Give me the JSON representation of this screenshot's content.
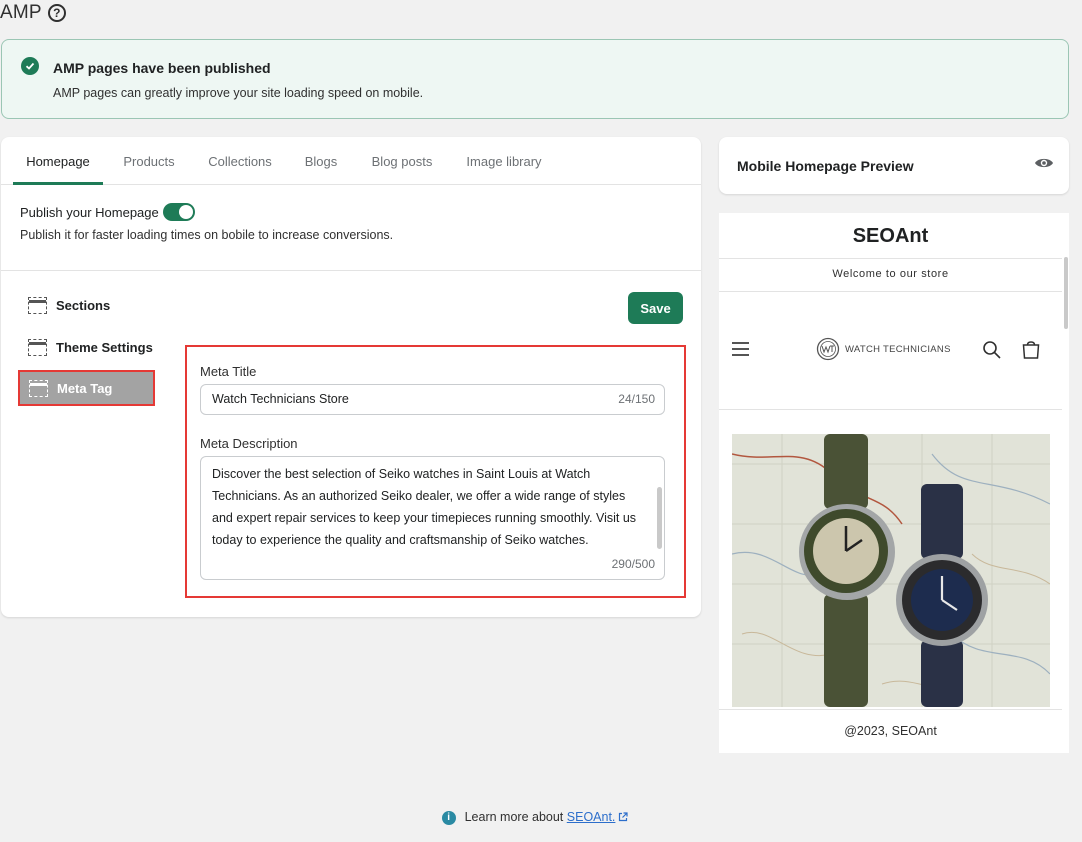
{
  "page": {
    "title": "AMP"
  },
  "banner": {
    "title": "AMP pages have been published",
    "text": "AMP pages can greatly improve your site loading speed on mobile."
  },
  "tabs": [
    {
      "label": "Homepage",
      "active": true
    },
    {
      "label": "Products"
    },
    {
      "label": "Collections"
    },
    {
      "label": "Blogs"
    },
    {
      "label": "Blog posts"
    },
    {
      "label": "Image library"
    }
  ],
  "publish": {
    "label": "Publish your Homepage",
    "enabled": true,
    "description": "Publish it for faster loading times on bobile to increase conversions."
  },
  "sidebar": {
    "items": [
      {
        "label": "Sections"
      },
      {
        "label": "Theme Settings"
      },
      {
        "label": "Meta Tag",
        "active": true
      }
    ]
  },
  "save_label": "Save",
  "meta": {
    "title_label": "Meta Title",
    "title_value": "Watch Technicians Store",
    "title_count": "24/150",
    "description_label": "Meta Description",
    "description_value": "Discover the best selection of Seiko watches in Saint Louis at Watch Technicians. As an authorized Seiko dealer, we offer a wide range of styles and expert repair services to keep your timepieces running smoothly. Visit us today to experience the quality and craftsmanship of Seiko watches.",
    "description_count": "290/500"
  },
  "preview": {
    "title": "Mobile Homepage Preview",
    "store_name": "SEOAnt",
    "welcome": "Welcome to our store",
    "logo_text": "WATCH TECHNICIANS",
    "copyright": "@2023, SEOAnt"
  },
  "footer": {
    "text": "Learn more about",
    "link": "SEOAnt."
  },
  "colors": {
    "accent": "#1e7b57",
    "highlight": "#e53935",
    "link": "#2c6ecb"
  }
}
